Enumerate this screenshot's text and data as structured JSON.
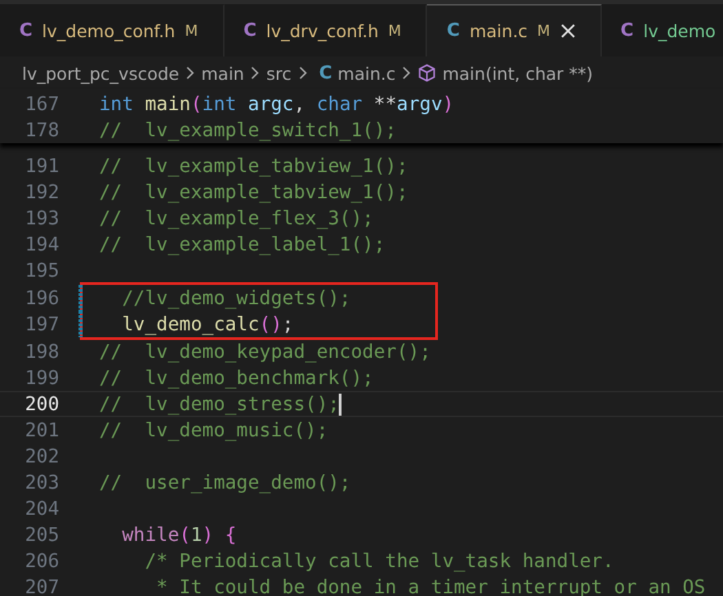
{
  "tabs": [
    {
      "icon": "C",
      "label": "lv_demo_conf.h",
      "kind": "header",
      "badge": "M",
      "selected": false,
      "color": "#d7ba7d"
    },
    {
      "icon": "C",
      "label": "lv_drv_conf.h",
      "kind": "header",
      "badge": "M",
      "selected": false,
      "color": "#d7ba7d"
    },
    {
      "icon": "C",
      "label": "main.c",
      "kind": "source",
      "badge": "M",
      "selected": true,
      "color": "#d7ba7d"
    },
    {
      "icon": "C",
      "label": "lv_demo",
      "kind": "header",
      "selected": false,
      "color": "#73c991"
    }
  ],
  "breadcrumbs": [
    {
      "kind": "folder",
      "label": "lv_port_pc_vscode"
    },
    {
      "kind": "folder",
      "label": "main"
    },
    {
      "kind": "folder",
      "label": "src"
    },
    {
      "kind": "file",
      "icon": "C",
      "label": "main.c"
    },
    {
      "kind": "symbol",
      "label": "main(int, char **)"
    }
  ],
  "sticky_lines": [
    {
      "number": "167",
      "tokens": [
        {
          "kind": "keyword",
          "text": "int"
        },
        {
          "kind": "function",
          "text": " main"
        },
        {
          "kind": "bracket",
          "text": "("
        },
        {
          "kind": "keyword",
          "text": "int"
        },
        {
          "kind": "param",
          "text": " argc"
        },
        {
          "kind": "plain",
          "text": ", "
        },
        {
          "kind": "keyword",
          "text": "char"
        },
        {
          "kind": "plain",
          "text": " **"
        },
        {
          "kind": "param",
          "text": "argv"
        },
        {
          "kind": "bracket",
          "text": ")"
        }
      ]
    },
    {
      "number": "178",
      "tokens": [
        {
          "kind": "comment",
          "text": "//  lv_example_switch_1();"
        }
      ]
    }
  ],
  "code_lines": [
    {
      "number": "191",
      "current": false,
      "modified": false,
      "boxed": false,
      "tokens": [
        {
          "kind": "comment",
          "text": "//  lv_example_tabview_1();"
        }
      ]
    },
    {
      "number": "192",
      "current": false,
      "modified": false,
      "boxed": false,
      "tokens": [
        {
          "kind": "comment",
          "text": "//  lv_example_tabview_1();"
        }
      ]
    },
    {
      "number": "193",
      "current": false,
      "modified": false,
      "boxed": false,
      "tokens": [
        {
          "kind": "comment",
          "text": "//  lv_example_flex_3();"
        }
      ]
    },
    {
      "number": "194",
      "current": false,
      "modified": false,
      "boxed": false,
      "tokens": [
        {
          "kind": "comment",
          "text": "//  lv_example_label_1();"
        }
      ]
    },
    {
      "number": "195",
      "current": false,
      "modified": false,
      "boxed": false
    },
    {
      "number": "196",
      "current": false,
      "modified": true,
      "boxed": true,
      "tokens": [
        {
          "kind": "comment",
          "text": "  //lv_demo_widgets();"
        }
      ]
    },
    {
      "number": "197",
      "current": false,
      "modified": true,
      "boxed": true,
      "tokens": [
        {
          "kind": "function",
          "text": "  lv_demo_calc"
        },
        {
          "kind": "bracket",
          "text": "()"
        },
        {
          "kind": "plain",
          "text": ";"
        }
      ]
    },
    {
      "number": "198",
      "current": false,
      "modified": false,
      "boxed": false,
      "tokens": [
        {
          "kind": "comment",
          "text": "//  lv_demo_keypad_encoder();"
        }
      ]
    },
    {
      "number": "199",
      "current": false,
      "modified": false,
      "boxed": false,
      "tokens": [
        {
          "kind": "comment",
          "text": "//  lv_demo_benchmark();"
        }
      ]
    },
    {
      "number": "200",
      "current": true,
      "modified": false,
      "boxed": false,
      "tokens": [
        {
          "kind": "comment",
          "text": "//  lv_demo_stress();"
        }
      ]
    },
    {
      "number": "201",
      "current": false,
      "modified": false,
      "boxed": false,
      "tokens": [
        {
          "kind": "comment",
          "text": "//  lv_demo_music();"
        }
      ]
    },
    {
      "number": "202",
      "current": false,
      "modified": false,
      "boxed": false
    },
    {
      "number": "203",
      "current": false,
      "modified": false,
      "boxed": false,
      "tokens": [
        {
          "kind": "comment",
          "text": "//  user_image_demo();"
        }
      ]
    },
    {
      "number": "204",
      "current": false,
      "modified": false,
      "boxed": false
    },
    {
      "number": "205",
      "current": false,
      "modified": false,
      "boxed": false,
      "tokens": [
        {
          "kind": "control",
          "text": "  while"
        },
        {
          "kind": "bracket",
          "text": "("
        },
        {
          "kind": "number",
          "text": "1"
        },
        {
          "kind": "bracket",
          "text": ")"
        },
        {
          "kind": "bracket",
          "text": " {"
        }
      ]
    },
    {
      "number": "206",
      "current": false,
      "modified": false,
      "boxed": false,
      "tokens": [
        {
          "kind": "comment",
          "text": "    /* Periodically call the lv_task handler."
        }
      ]
    },
    {
      "number": "207",
      "current": false,
      "modified": false,
      "boxed": false,
      "tokens": [
        {
          "kind": "comment",
          "text": "     * It could be done in a timer interrupt or an OS"
        }
      ]
    }
  ]
}
